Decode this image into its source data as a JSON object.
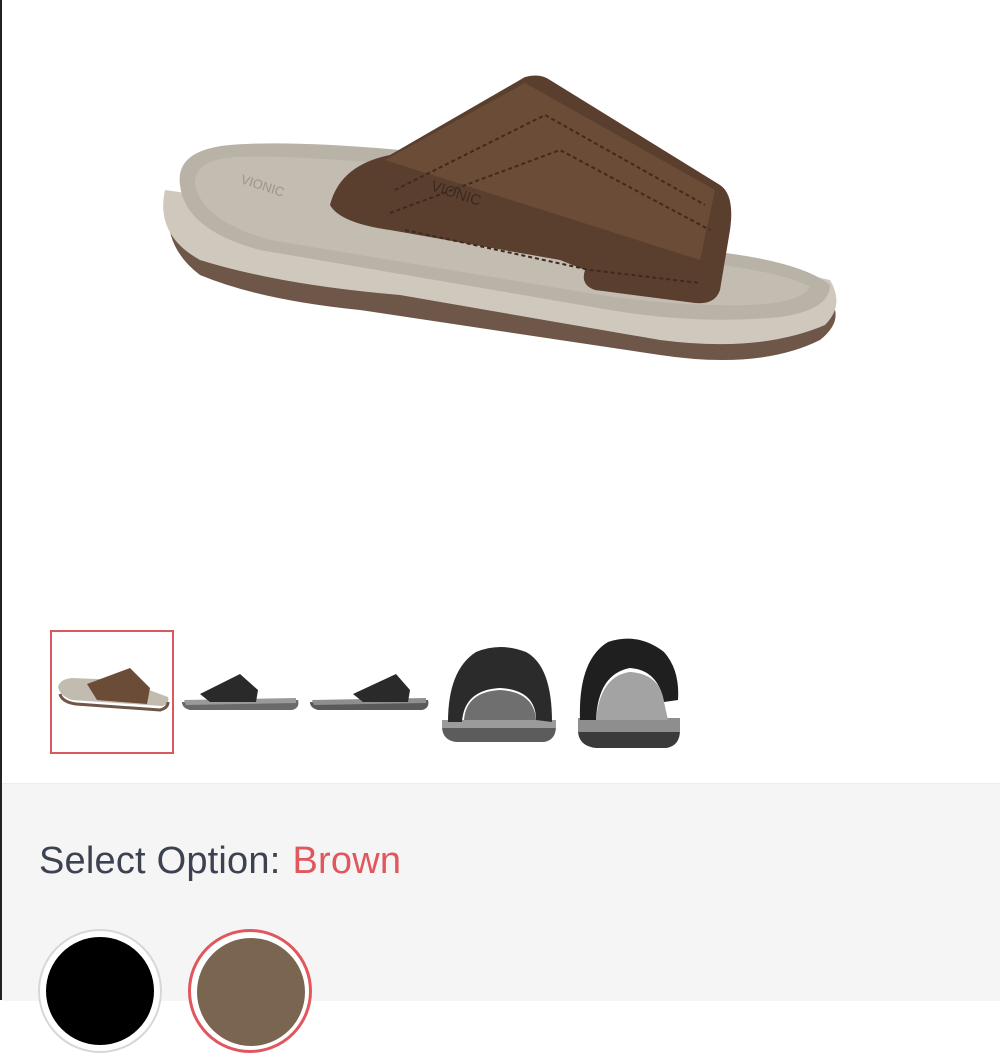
{
  "product": {
    "brand_mark": "VIONIC",
    "main_image": "brown-slide-sandal-side-view"
  },
  "thumbnails": [
    {
      "name": "brown-side",
      "color": "#6b4d3a",
      "selected": true
    },
    {
      "name": "black-side",
      "color": "#2a2a2a",
      "selected": false
    },
    {
      "name": "black-side-alt",
      "color": "#2a2a2a",
      "selected": false
    },
    {
      "name": "black-front",
      "color": "#2a2a2a",
      "selected": false
    },
    {
      "name": "black-back",
      "color": "#2a2a2a",
      "selected": false
    }
  ],
  "options": {
    "label": "Select Option:",
    "selected_value": "Brown",
    "swatches": [
      {
        "name": "Black",
        "color": "#000000",
        "selected": false
      },
      {
        "name": "Brown",
        "color": "#7a6650",
        "selected": true
      }
    ]
  },
  "colors": {
    "accent": "#e0575e",
    "label_text": "#3d4251",
    "panel_bg": "#f5f5f5"
  }
}
